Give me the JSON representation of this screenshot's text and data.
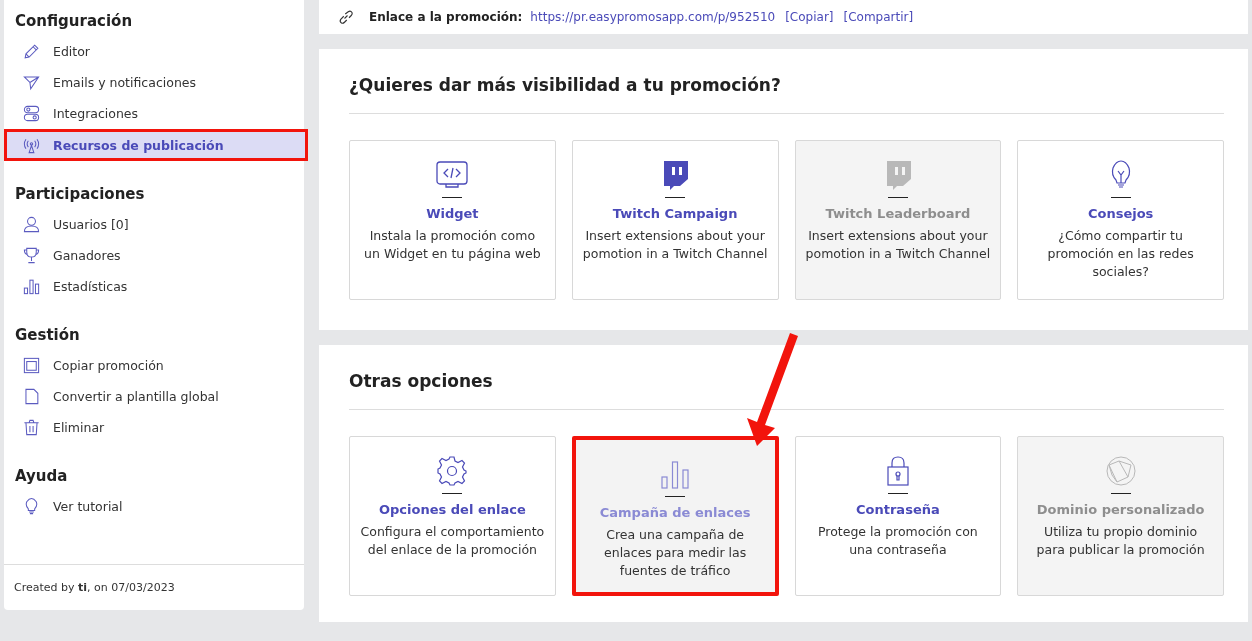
{
  "sidebar": {
    "sections": [
      {
        "title": "Configuración",
        "items": [
          {
            "label": "Editor",
            "kind": "pencil",
            "selected": false
          },
          {
            "label": "Emails y notificaciones",
            "kind": "send",
            "selected": false
          },
          {
            "label": "Integraciones",
            "kind": "toggles",
            "selected": false
          },
          {
            "label": "Recursos de publicación",
            "kind": "antenna",
            "selected": true
          }
        ]
      },
      {
        "title": "Participaciones",
        "items": [
          {
            "label": "Usuarios [0]",
            "kind": "user",
            "selected": false
          },
          {
            "label": "Ganadores",
            "kind": "trophy",
            "selected": false
          },
          {
            "label": "Estadísticas",
            "kind": "bars",
            "selected": false
          }
        ]
      },
      {
        "title": "Gestión",
        "items": [
          {
            "label": "Copiar promoción",
            "kind": "copy",
            "selected": false
          },
          {
            "label": "Convertir a plantilla global",
            "kind": "file",
            "selected": false
          },
          {
            "label": "Eliminar",
            "kind": "trash",
            "selected": false
          }
        ]
      },
      {
        "title": "Ayuda",
        "items": [
          {
            "label": "Ver tutorial",
            "kind": "bulb",
            "selected": false
          }
        ]
      }
    ],
    "footer": "Created by **ti**, on 07/03/2023"
  },
  "link_bar": {
    "label": "Enlace a la promoción:",
    "url": "https://pr.easypromosapp.com/p/952510",
    "actions": [
      "[Copiar]",
      "[Compartir]"
    ]
  },
  "sections": [
    {
      "title": "¿Quieres dar más visibilidad a tu promoción?",
      "cards": [
        {
          "kind": "code",
          "title": "Widget",
          "text": "Instala la promoción como un Widget en tu página web",
          "disabled": false,
          "hovered": false,
          "highlighted": false
        },
        {
          "kind": "twitch",
          "title": "Twitch Campaign",
          "text": "Insert extensions about your pomotion in a Twitch Channel",
          "disabled": false,
          "hovered": false,
          "highlighted": false
        },
        {
          "kind": "twitch",
          "title": "Twitch Leaderboard",
          "text": "Insert extensions about your pomotion in a Twitch Channel",
          "disabled": true,
          "hovered": false,
          "highlighted": false
        },
        {
          "kind": "bulb",
          "title": "Consejos",
          "text": "¿Cómo compartir tu promoción en las redes sociales?",
          "disabled": false,
          "hovered": false,
          "highlighted": false
        }
      ]
    },
    {
      "title": "Otras opciones",
      "cards": [
        {
          "kind": "gear",
          "title": "Opciones del enlace",
          "text": "Configura el comportamiento del enlace de la promoción",
          "disabled": false,
          "hovered": false,
          "highlighted": false
        },
        {
          "kind": "bars",
          "title": "Campaña de enlaces",
          "text": "Crea una campaña de enlaces para medir las fuentes de tráfico",
          "disabled": false,
          "hovered": true,
          "highlighted": true
        },
        {
          "kind": "lock",
          "title": "Contraseña",
          "text": "Protege la promoción con una contraseña",
          "disabled": false,
          "hovered": false,
          "highlighted": false
        },
        {
          "kind": "globe",
          "title": "Dominio personalizado",
          "text": "Utiliza tu propio dominio para publicar la promoción",
          "disabled": true,
          "hovered": false,
          "highlighted": false
        }
      ]
    }
  ]
}
